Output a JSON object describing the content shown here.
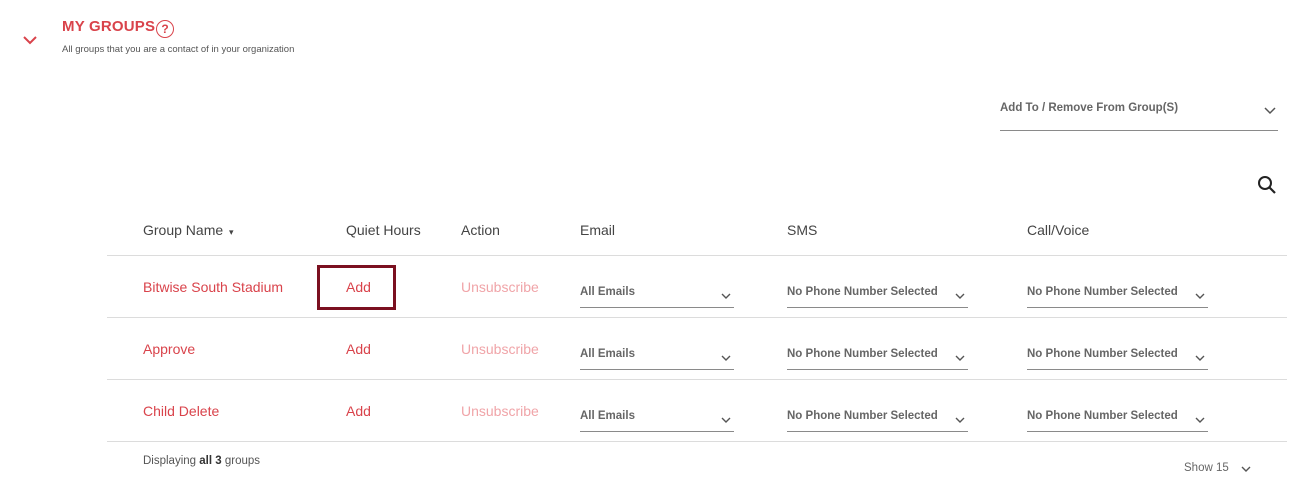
{
  "header": {
    "title": "MY GROUPS",
    "help_glyph": "?",
    "subtitle": "All groups that you are a contact of in your organization"
  },
  "group_action": {
    "label": "Add To / Remove From Group(S)"
  },
  "table": {
    "columns": {
      "group_name": "Group Name",
      "quiet_hours": "Quiet Hours",
      "action": "Action",
      "email": "Email",
      "sms": "SMS",
      "call_voice": "Call/Voice"
    },
    "rows": [
      {
        "name": "Bitwise South Stadium",
        "quiet_hours": "Add",
        "action": "Unsubscribe",
        "email": "All Emails",
        "sms": "No Phone Number Selected",
        "call": "No Phone Number Selected"
      },
      {
        "name": "Approve",
        "quiet_hours": "Add",
        "action": "Unsubscribe",
        "email": "All Emails",
        "sms": "No Phone Number Selected",
        "call": "No Phone Number Selected"
      },
      {
        "name": "Child Delete",
        "quiet_hours": "Add",
        "action": "Unsubscribe",
        "email": "All Emails",
        "sms": "No Phone Number Selected",
        "call": "No Phone Number Selected"
      }
    ]
  },
  "footer": {
    "displaying_prefix": "Displaying",
    "displaying_bold": "all 3",
    "displaying_suffix": "groups",
    "show_label": "Show 15"
  },
  "icons": {
    "collapse": "chevron-down-icon",
    "help": "help-circle-icon",
    "search": "search-icon",
    "dropdown": "chevron-down-icon"
  },
  "colors": {
    "accent": "#d9434b",
    "disabled_link": "#f0a4a8",
    "highlight_border": "#7b1020"
  }
}
